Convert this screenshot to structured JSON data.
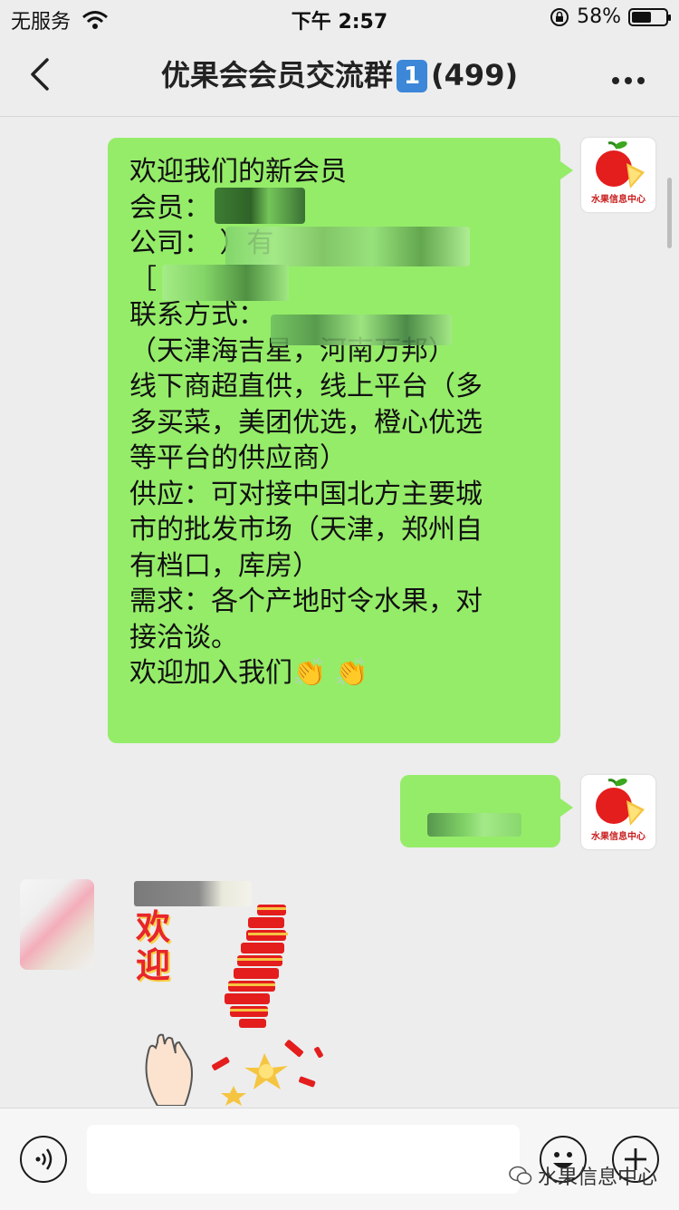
{
  "status": {
    "carrier": "无服务",
    "time": "下午 2:57",
    "battery": "58%",
    "battery_level": 0.58
  },
  "header": {
    "title": "优果会会员交流群",
    "unread_badge": "1",
    "member_count": "(499)"
  },
  "messages": [
    {
      "sender": "self",
      "avatar_caption": "水果信息中心",
      "lines": [
        "欢迎我们的新会员",
        "会员：",
        "公司：                    ）有",
        "［",
        "联系方式：",
        "  （天津海吉星，河南万邦）",
        "线下商超直供，线上平台（多",
        "多买菜，美团优选，橙心优选",
        "等平台的供应商）",
        "供应：可对接中国北方主要城",
        "市的批发市场（天津，郑州自",
        "有档口，库房）",
        "需求：各个产地时令水果，对",
        "接洽谈。",
        "欢迎加入我们👏 👏"
      ]
    },
    {
      "sender": "self",
      "avatar_caption": "水果信息中心",
      "lines": []
    },
    {
      "sender": "friend",
      "sticker_text": [
        "欢",
        "迎"
      ]
    }
  ],
  "input_bar": {
    "watermark": "水果信息中心"
  },
  "icons": [
    "back-icon",
    "more-icon",
    "wifi-icon",
    "lock-rotation-icon",
    "battery-icon",
    "voice-icon",
    "emoji-icon",
    "plus-icon",
    "wechat-logo-icon"
  ]
}
